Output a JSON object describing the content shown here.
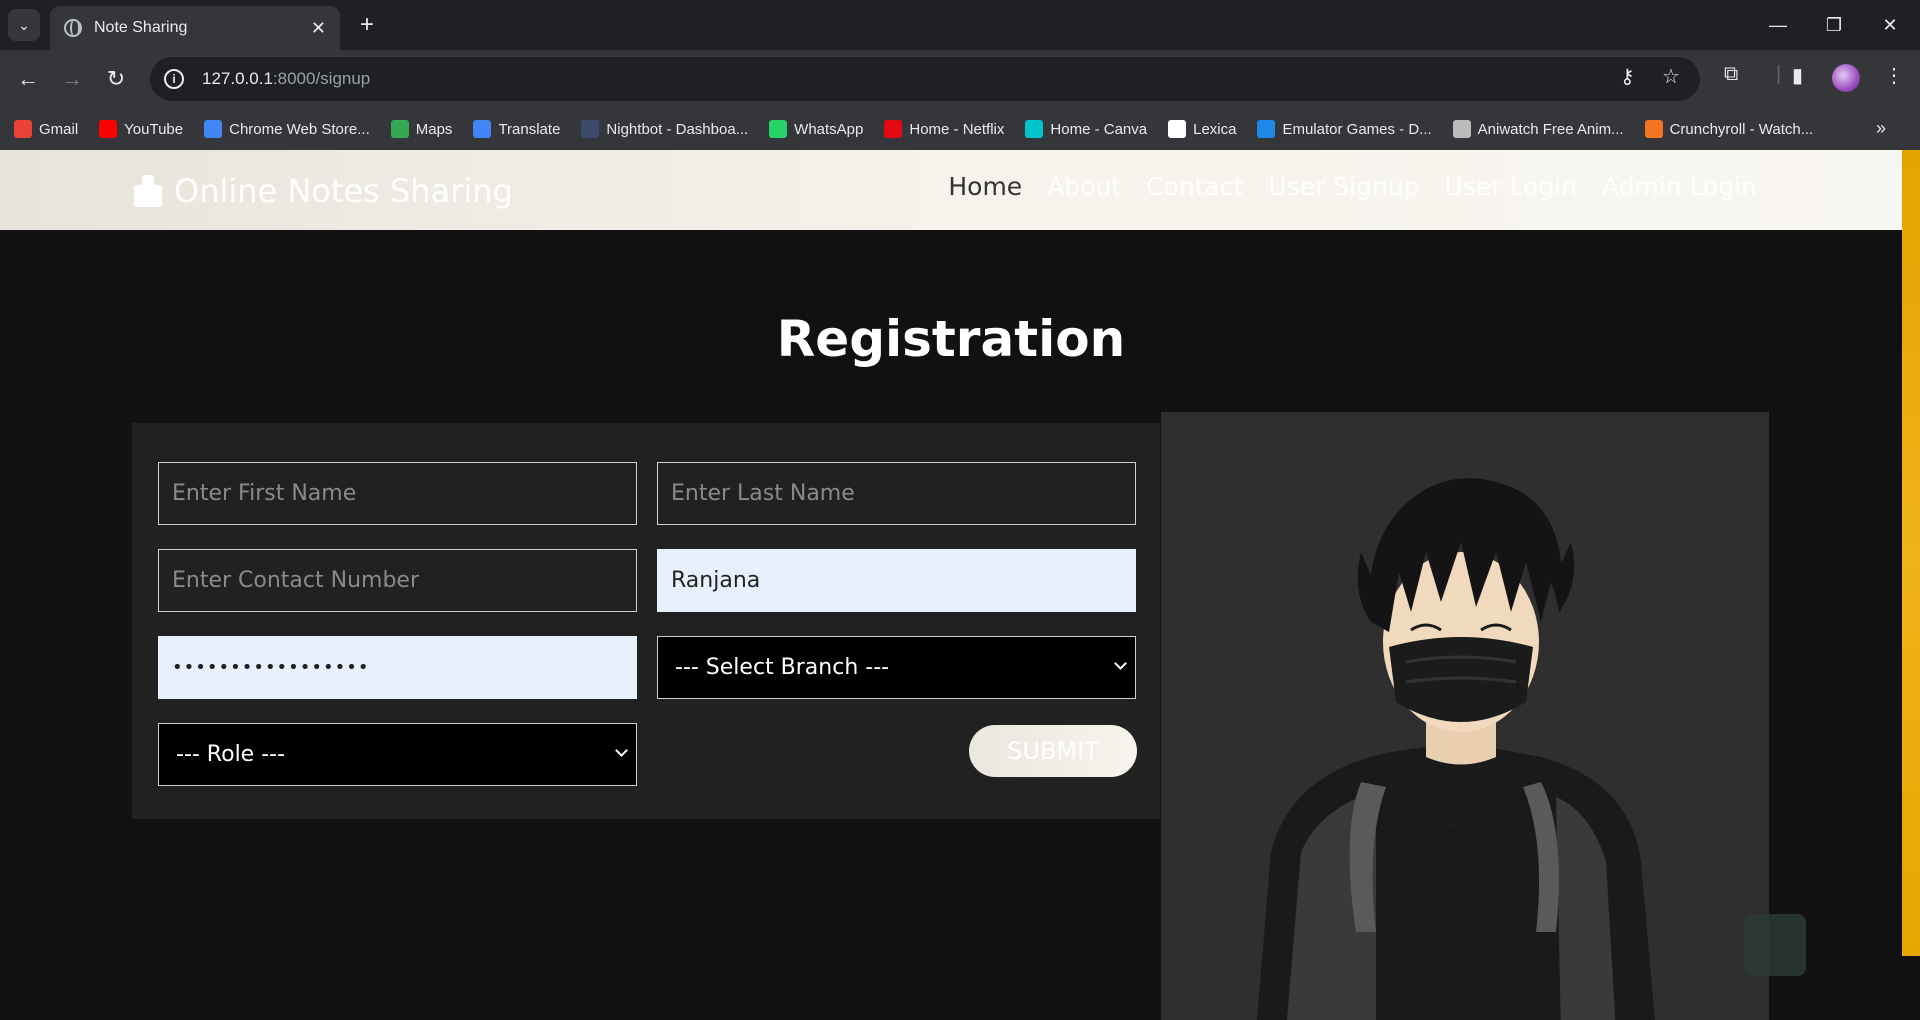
{
  "browser": {
    "tab_title": "Note Sharing",
    "url_host": "127.0.0.1",
    "url_path": ":8000/signup",
    "bookmarks": [
      {
        "label": "Gmail",
        "color": "#ea4335"
      },
      {
        "label": "YouTube",
        "color": "#ff0000"
      },
      {
        "label": "Chrome Web Store...",
        "color": "#4285f4"
      },
      {
        "label": "Maps",
        "color": "#34a853"
      },
      {
        "label": "Translate",
        "color": "#4285f4"
      },
      {
        "label": "Nightbot - Dashboa...",
        "color": "#3b4a6b"
      },
      {
        "label": "WhatsApp",
        "color": "#25d366"
      },
      {
        "label": "Home - Netflix",
        "color": "#e50914"
      },
      {
        "label": "Home - Canva",
        "color": "#00c4cc"
      },
      {
        "label": "Lexica",
        "color": "#ffffff"
      },
      {
        "label": "Emulator Games - D...",
        "color": "#1e88e5"
      },
      {
        "label": "Aniwatch Free Anim...",
        "color": "#bbbbbb"
      },
      {
        "label": "Crunchyroll - Watch...",
        "color": "#f47521"
      }
    ]
  },
  "navbar": {
    "brand": "Online Notes Sharing",
    "links": [
      "Home",
      "About",
      "Contact",
      "User Signup",
      "User Login",
      "Admin Login"
    ]
  },
  "form": {
    "title": "Registration",
    "first_name_placeholder": "Enter First Name",
    "last_name_placeholder": "Enter Last Name",
    "contact_placeholder": "Enter Contact Number",
    "email_value": "Ranjana",
    "password_mask": "•••••••••••••••••",
    "branch_selected": "--- Select Branch ---",
    "role_selected": "--- Role ---",
    "submit_label": "SUBMIT"
  },
  "colors": {
    "page_bg": "#111111",
    "card_bg": "#212121",
    "autofill_bg": "#e8f0fe",
    "accent_scroll": "#f0b21a"
  }
}
